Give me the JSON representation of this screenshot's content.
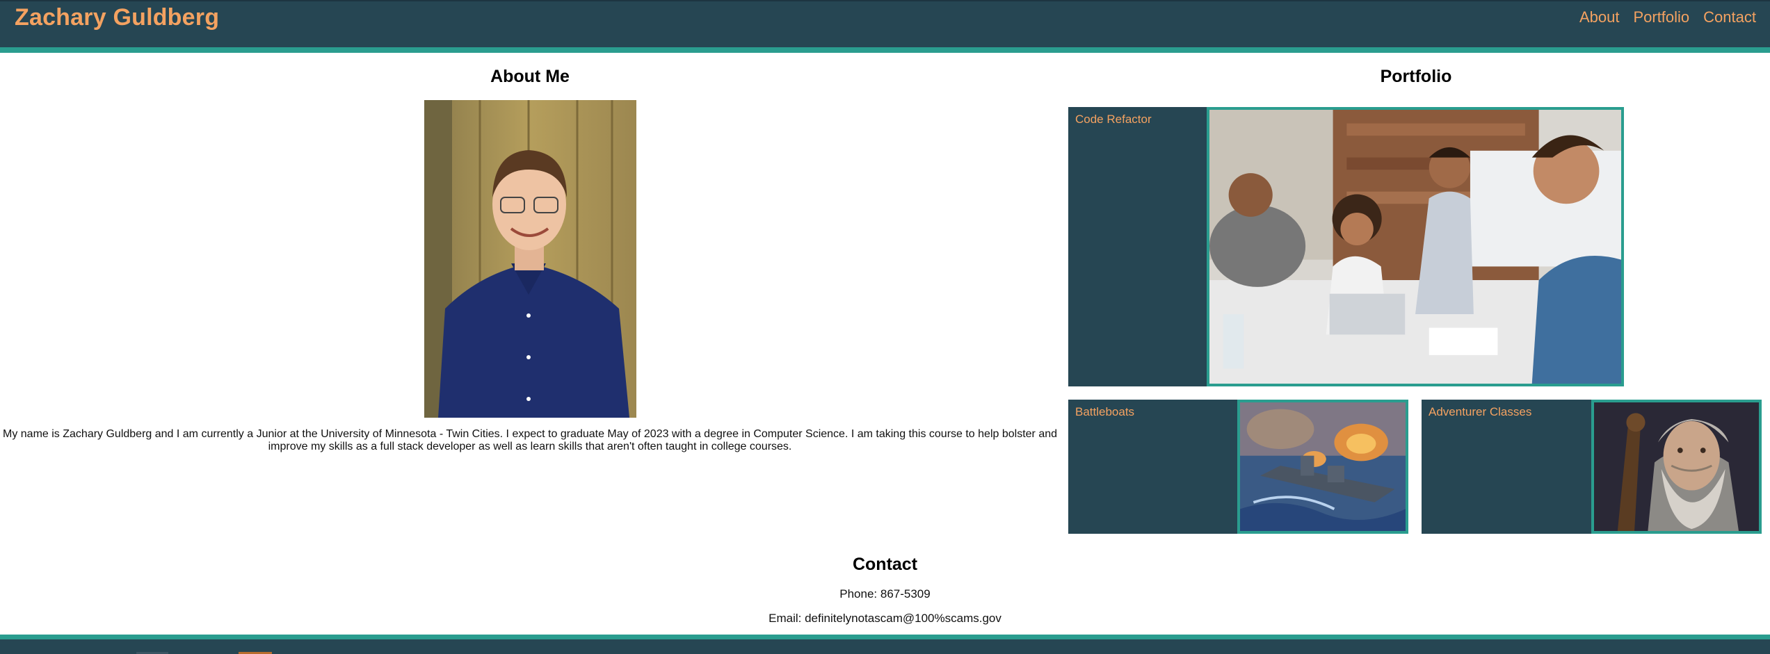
{
  "header": {
    "site_title": "Zachary Guldberg",
    "nav": [
      {
        "label": "About"
      },
      {
        "label": "Portfolio"
      },
      {
        "label": "Contact"
      }
    ]
  },
  "about": {
    "title": "About Me",
    "photo_alt": "portrait-photo",
    "text": "My name is Zachary Guldberg and I am currently a Junior at the University of Minnesota - Twin Cities. I expect to graduate May of 2023 with a degree in Computer Science. I am taking this course to help bolster and improve my skills as a full stack developer as well as learn skills that aren't often taught in college courses."
  },
  "portfolio": {
    "title": "Portfolio",
    "projects": [
      {
        "label": "Code Refactor"
      },
      {
        "label": "Battleboats"
      },
      {
        "label": "Adventurer Classes"
      }
    ]
  },
  "contact": {
    "title": "Contact",
    "phone": "Phone: 867-5309",
    "email": "Email: definitelynotascam@100%scams.gov"
  },
  "colors": {
    "primary": "#264653",
    "accent": "#2a9d8f",
    "highlight": "#f4a261",
    "background": "#ffffff"
  }
}
